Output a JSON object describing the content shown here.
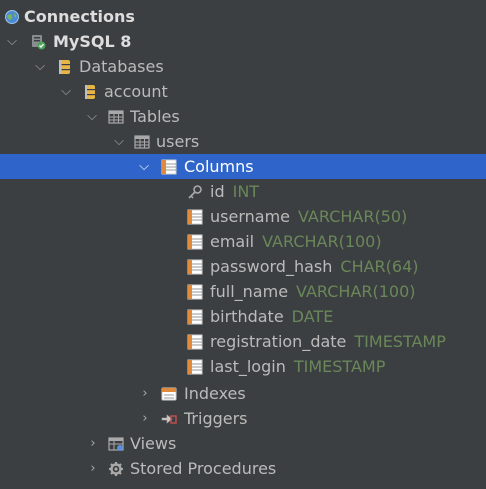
{
  "tree": {
    "connections": {
      "label": "Connections"
    },
    "server": {
      "label": "MySQL 8"
    },
    "databases": {
      "label": "Databases"
    },
    "database": {
      "label": "account"
    },
    "tables": {
      "label": "Tables"
    },
    "table": {
      "label": "users"
    },
    "columns_folder": {
      "label": "Columns"
    },
    "columns": [
      {
        "name": "id",
        "type": "INT",
        "icon": "key-icon"
      },
      {
        "name": "username",
        "type": "VARCHAR(50)",
        "icon": "column-icon"
      },
      {
        "name": "email",
        "type": "VARCHAR(100)",
        "icon": "column-icon"
      },
      {
        "name": "password_hash",
        "type": "CHAR(64)",
        "icon": "column-icon"
      },
      {
        "name": "full_name",
        "type": "VARCHAR(100)",
        "icon": "column-icon"
      },
      {
        "name": "birthdate",
        "type": "DATE",
        "icon": "column-icon"
      },
      {
        "name": "registration_date",
        "type": "TIMESTAMP",
        "icon": "column-icon"
      },
      {
        "name": "last_login",
        "type": "TIMESTAMP",
        "icon": "column-icon"
      }
    ],
    "indexes": {
      "label": "Indexes"
    },
    "triggers": {
      "label": "Triggers"
    },
    "views": {
      "label": "Views"
    },
    "procedures": {
      "label": "Stored Procedures"
    }
  },
  "colors": {
    "background": "#3c3f41",
    "selection": "#2f65ca",
    "text": "#bbbbbb",
    "type_text": "#6a8759",
    "db_icon": "#e7b547"
  }
}
